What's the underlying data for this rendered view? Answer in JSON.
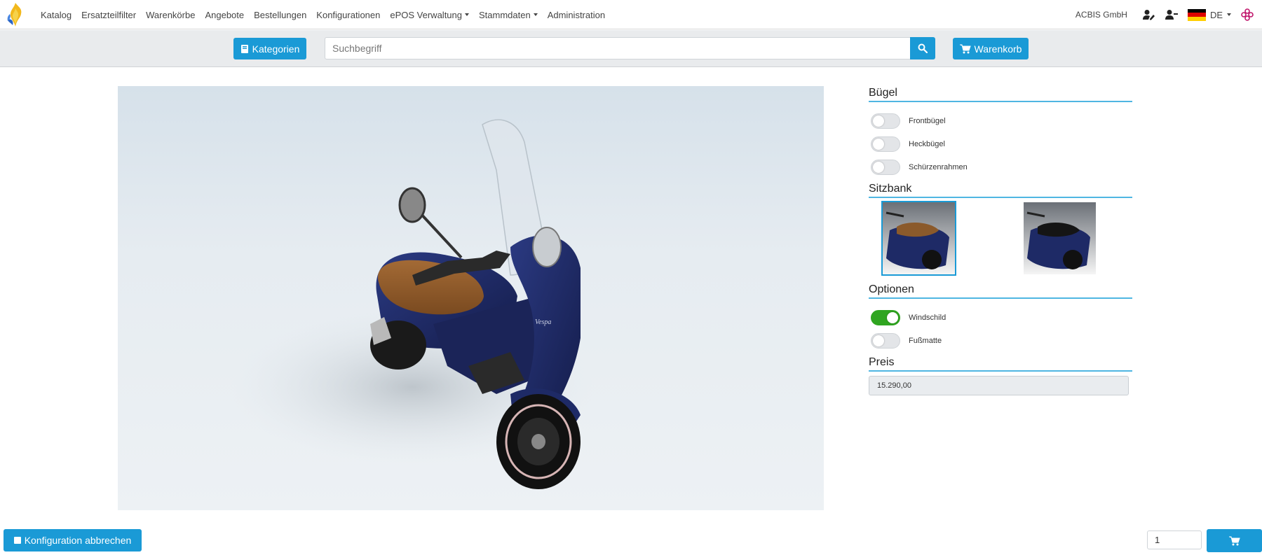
{
  "nav": {
    "items": [
      {
        "label": "Katalog",
        "dropdown": false
      },
      {
        "label": "Ersatzteilfilter",
        "dropdown": false
      },
      {
        "label": "Warenkörbe",
        "dropdown": false
      },
      {
        "label": "Angebote",
        "dropdown": false
      },
      {
        "label": "Bestellungen",
        "dropdown": false
      },
      {
        "label": "Konfigurationen",
        "dropdown": false
      },
      {
        "label": "ePOS Verwaltung",
        "dropdown": true
      },
      {
        "label": "Stammdaten",
        "dropdown": true
      },
      {
        "label": "Administration",
        "dropdown": false
      }
    ],
    "company": "ACBIS GmbH",
    "language": "DE",
    "icons": [
      "logo-flame-icon",
      "user-edit-icon",
      "user-minus-icon",
      "flag-de-icon",
      "brand-flower-icon"
    ]
  },
  "search": {
    "categories_label": "Kategorien",
    "placeholder": "Suchbegriff",
    "cart_label": "Warenkorb"
  },
  "config": {
    "sections": {
      "buegel": {
        "title": "Bügel",
        "options": [
          {
            "label": "Frontbügel",
            "on": false
          },
          {
            "label": "Heckbügel",
            "on": false
          },
          {
            "label": "Schürzenrahmen",
            "on": false
          }
        ]
      },
      "sitzbank": {
        "title": "Sitzbank",
        "variants": [
          {
            "name": "brown-seat",
            "selected": true
          },
          {
            "name": "black-seat",
            "selected": false
          }
        ]
      },
      "optionen": {
        "title": "Optionen",
        "options": [
          {
            "label": "Windschild",
            "on": true
          },
          {
            "label": "Fußmatte",
            "on": false
          }
        ]
      },
      "preis": {
        "title": "Preis",
        "value": "15.290,00"
      }
    }
  },
  "footer": {
    "cancel_label": "Konfiguration abbrechen",
    "quantity": "1"
  },
  "colors": {
    "primary": "#1a9ad6",
    "toggle_on": "#2fa520",
    "accent_line": "#4fb6e2",
    "scooter_body": "#1e2a66",
    "seat_brown": "#8b5a2b"
  }
}
